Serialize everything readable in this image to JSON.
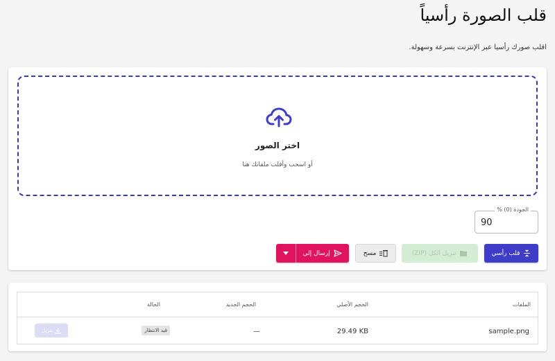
{
  "page": {
    "title": "قلب الصورة رأسياً",
    "subtitle": "اقلب صورك رأسيا عبر الإنترنت بسرعة وسهولة."
  },
  "dropzone": {
    "title": "اختر الصور",
    "hint": "أو اسحب وأفلت ملفاتك هنا",
    "icon": "cloud-upload-icon"
  },
  "quality": {
    "label": "الجودة (0) %",
    "value": "90"
  },
  "actions": {
    "flip_label": "قلب رأسي",
    "download_all_label": "تنزيل الكل (ZIP)",
    "clear_label": "مسح",
    "send_label": "إرسال إلى"
  },
  "table": {
    "headers": {
      "files": "الملفات",
      "original_size": "الحجم الأصلي",
      "new_size": "الحجم الجديد",
      "status": "الحالة"
    },
    "rows": [
      {
        "name": "sample.png",
        "original_size": "29.49 KB",
        "new_size": "—",
        "status": "قيد الانتظار",
        "download_label": "تنزيل"
      }
    ]
  },
  "colors": {
    "primary": "#3f3dc8",
    "accent": "#e0145e",
    "dropzone_border": "#3b3bb0",
    "success_disabled": "#d3ecd3"
  }
}
